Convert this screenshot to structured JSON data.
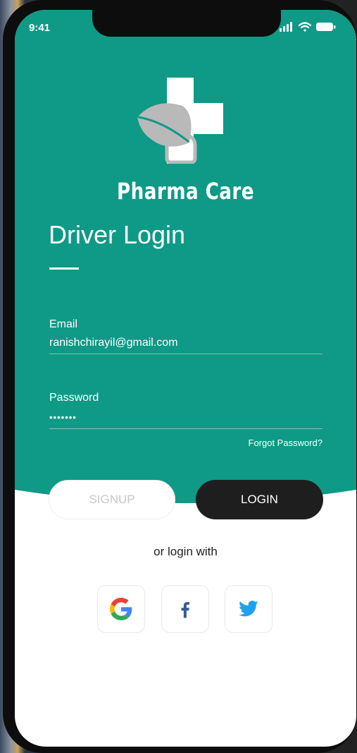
{
  "status_bar": {
    "time": "9:41",
    "icons": [
      "signal-icon",
      "wifi-icon",
      "battery-icon"
    ]
  },
  "app": {
    "name": "Pharma Care",
    "logo_icon": "cross-leaf-logo"
  },
  "screen": {
    "title": "Driver Login"
  },
  "form": {
    "email": {
      "label": "Email",
      "value": "ranishchirayil@gmail.com"
    },
    "password": {
      "label": "Password",
      "value": "•••••••"
    },
    "forgot_password": "Forgot Password?"
  },
  "buttons": {
    "signup": "SIGNUP",
    "login": "LOGIN"
  },
  "social_login": {
    "prompt": "or login with",
    "providers": [
      "google-icon",
      "facebook-icon",
      "twitter-icon"
    ]
  },
  "colors": {
    "primary": "#0E9A86",
    "dark_button": "#1E1E1E",
    "logo_leaf": "#B9B9B9",
    "facebook": "#3B5998",
    "twitter": "#1DA1F2"
  }
}
